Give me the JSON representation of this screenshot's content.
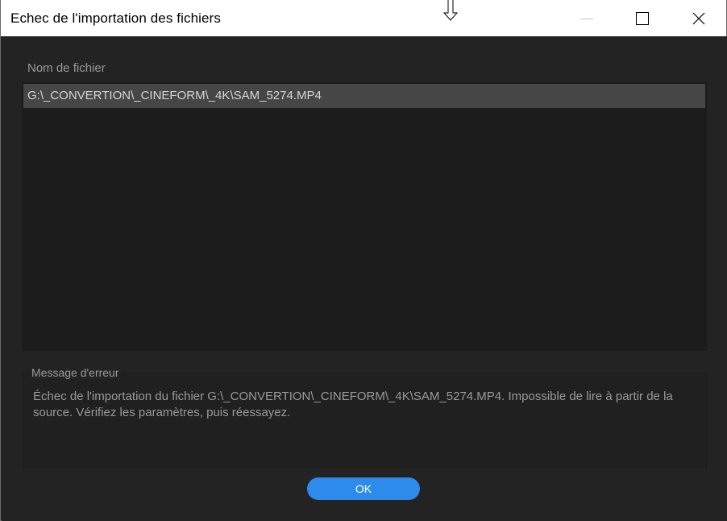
{
  "window": {
    "title": "Echec de l'importation des fichiers",
    "controls": {
      "minimize_icon": "minimize-icon",
      "maximize_icon": "maximize-icon",
      "close_icon": "close-icon"
    }
  },
  "file_list": {
    "header": "Nom de fichier",
    "items": [
      {
        "path": "G:\\_CONVERTION\\_CINEFORM\\_4K\\SAM_5274.MP4"
      }
    ]
  },
  "error": {
    "label": "Message d'erreur",
    "message": "Échec de l'importation du fichier G:\\_CONVERTION\\_CINEFORM\\_4K\\SAM_5274.MP4. Impossible de lire à partir de la source. Vérifiez les paramètres, puis réessayez."
  },
  "actions": {
    "ok_label": "OK"
  },
  "colors": {
    "accent": "#2d8ceb",
    "background": "#232323",
    "selected_row": "#464646"
  }
}
